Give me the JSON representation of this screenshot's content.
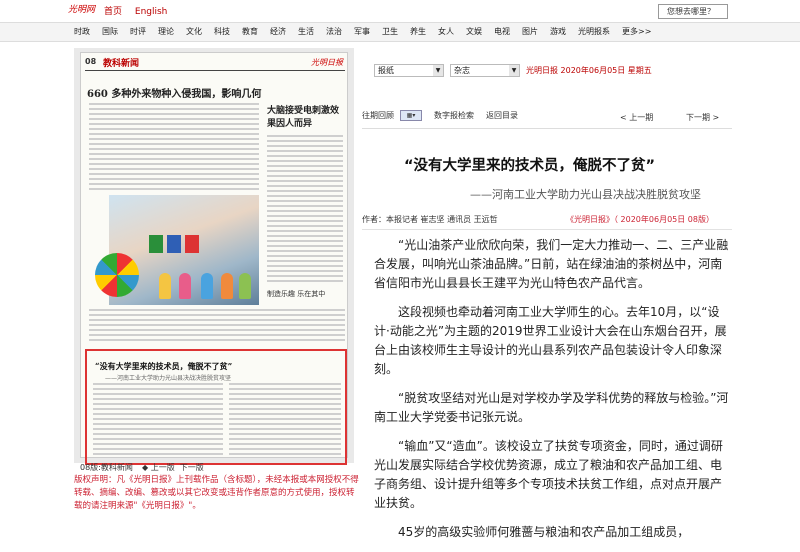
{
  "header": {
    "logo": "光明网",
    "links": [
      "首页",
      "English"
    ],
    "search_placeholder": "您想去哪里？"
  },
  "nav": [
    "时政",
    "国际",
    "时评",
    "理论",
    "文化",
    "科技",
    "教育",
    "经济",
    "生活",
    "法治",
    "军事",
    "卫生",
    "养生",
    "女人",
    "文娱",
    "电视",
    "图片",
    "游戏",
    "光明报系",
    "更多>>"
  ],
  "paper": {
    "page_no": "08",
    "section": "教科新闻",
    "masthead": "光明日报",
    "headline_main": "660 多种外来物种入侵我国，影响几何",
    "headline_side": "大脑接受电刺激效果因人而异",
    "photo_caption": "制造乐趣 乐在其中",
    "highlight_title": "“没有大学里来的技术员，俺脱不了贫”",
    "highlight_sub": "——河南工业大学助力光山县决战决胜脱贫攻坚",
    "footer_label": "08版:教科新闻",
    "prev_page": "上一版",
    "next_page": "下一版"
  },
  "disclaimer": "版权声明：凡《光明日报》上刊载作品（含标题），未经本报或本网授权不得转载、摘编、改编、篡改或以其它改变或违背作者原意的方式使用，授权转载的请注明来源\"《光明日报》\"。",
  "controls": {
    "select1": "报纸",
    "select2": "杂志",
    "dateline": "光明日报 2020年06月05日 星期五"
  },
  "toolbar": {
    "back_issues": "往期回顾",
    "search_issues": "数字报检索",
    "back_to_index": "返回目录",
    "prev_article": "< 上一期",
    "next_article": "下一期 >"
  },
  "article": {
    "title": "“没有大学里来的技术员，俺脱不了贫”",
    "subtitle": "——河南工业大学助力光山县决战决胜脱贫攻坚",
    "byline": "作者：本报记者 崔志坚 通讯员 王远哲",
    "source": "《光明日报》（ 2020年06月05日 08版）",
    "paragraphs": [
      "“光山油茶产业欣欣向荣，我们一定大力推动一、二、三产业融合发展，叫响光山茶油品牌。”日前，站在绿油油的茶树丛中，河南省信阳市光山县县长王建平为光山特色农产品代言。",
      "这段视频也牵动着河南工业大学师生的心。去年10月，以“设计·动能之光”为主题的2019世界工业设计大会在山东烟台召开，展台上由该校师生主导设计的光山县系列农产品包装设计令人印象深刻。",
      "“脱贫攻坚结对光山是对学校办学及学科优势的释放与检验。”河南工业大学党委书记张元说。",
      "“输血”又“造血”。该校设立了扶贫专项资金，同时，通过调研光山发展实际结合学校优势资源，成立了粮油和农产品加工组、电子商务组、设计提升组等多个专项技术扶贫工作组，点对点开展产业扶贫。",
      "45岁的高级实验师何雅蔷与粮油和农产品加工组成员，"
    ]
  }
}
